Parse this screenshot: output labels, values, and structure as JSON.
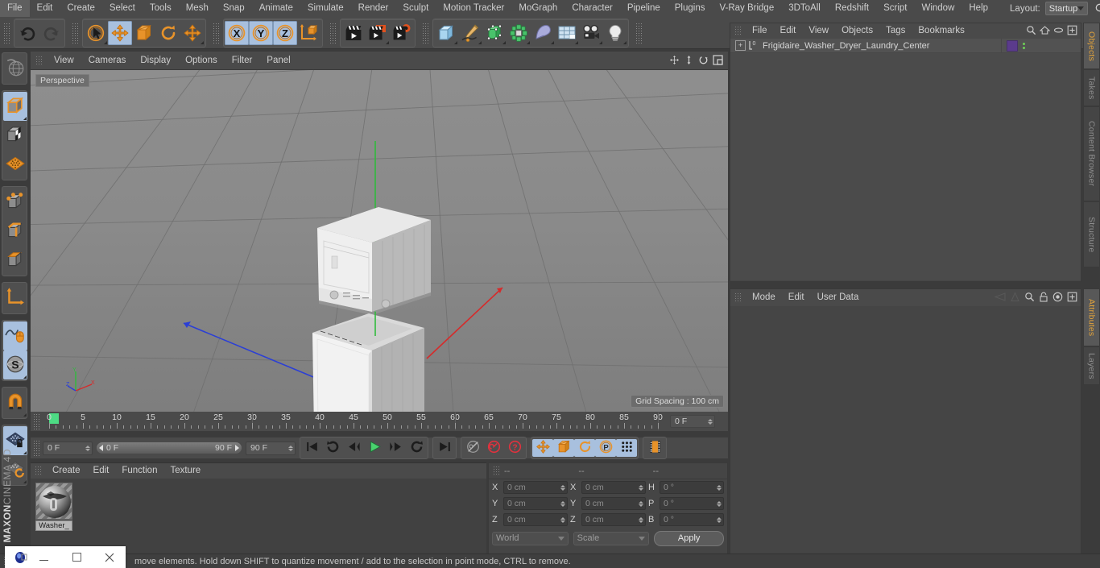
{
  "app": {
    "name": "CINEMA 4D",
    "vendor": "MAXON"
  },
  "menubar": {
    "items": [
      "File",
      "Edit",
      "Create",
      "Select",
      "Tools",
      "Mesh",
      "Snap",
      "Animate",
      "Simulate",
      "Render",
      "Sculpt",
      "Motion Tracker",
      "MoGraph",
      "Character",
      "Pipeline",
      "Plugins",
      "V-Ray Bridge",
      "3DToAll",
      "Redshift",
      "Script",
      "Window",
      "Help"
    ],
    "layout_label": "Layout:",
    "layout_value": "Startup",
    "search_icon": "magnifier-icon"
  },
  "toolbar": {
    "groups": [
      {
        "name": "history",
        "buttons": [
          {
            "name": "undo-button",
            "icon": "undo-arrow-icon",
            "selected": false,
            "corner": false
          },
          {
            "name": "redo-button",
            "icon": "redo-arrow-icon",
            "selected": false,
            "corner": false
          }
        ]
      },
      {
        "name": "transform",
        "buttons": [
          {
            "name": "live-selection-button",
            "icon": "cursor-circle-icon",
            "selected": false,
            "corner": true
          },
          {
            "name": "move-button",
            "icon": "move-arrows-icon",
            "selected": true,
            "corner": false
          },
          {
            "name": "scale-button",
            "icon": "scale-box-icon",
            "selected": false,
            "corner": false
          },
          {
            "name": "rotate-button",
            "icon": "rotate-circle-icon",
            "selected": false,
            "corner": false
          },
          {
            "name": "free-move-button",
            "icon": "move-arrows-icon",
            "selected": false,
            "corner": true
          }
        ]
      },
      {
        "name": "axis-locks",
        "buttons": [
          {
            "name": "x-axis-lock-button",
            "icon": "x-axis-icon",
            "selected": true,
            "corner": false
          },
          {
            "name": "y-axis-lock-button",
            "icon": "y-axis-icon",
            "selected": true,
            "corner": false
          },
          {
            "name": "z-axis-lock-button",
            "icon": "z-axis-icon",
            "selected": true,
            "corner": false
          },
          {
            "name": "world-object-coordinates-button",
            "icon": "world-axis-cube-icon",
            "selected": false,
            "corner": false
          }
        ]
      },
      {
        "name": "render",
        "buttons": [
          {
            "name": "render-view-button",
            "icon": "clapperboard-icon",
            "selected": false,
            "corner": false
          },
          {
            "name": "render-to-picture-viewer-button",
            "icon": "clapperboard-picture-icon",
            "selected": false,
            "corner": true
          },
          {
            "name": "render-settings-button",
            "icon": "clapperboard-gear-icon",
            "selected": false,
            "corner": false
          }
        ]
      },
      {
        "name": "create",
        "buttons": [
          {
            "name": "add-cube-button",
            "icon": "cube-icon",
            "selected": false,
            "corner": true
          },
          {
            "name": "add-spline-button",
            "icon": "pen-spline-icon",
            "selected": false,
            "corner": true
          },
          {
            "name": "add-nurbs-button",
            "icon": "green-nurbs-cube-icon",
            "selected": false,
            "corner": true
          },
          {
            "name": "add-array-button",
            "icon": "green-array-icon",
            "selected": false,
            "corner": true
          },
          {
            "name": "add-deformer-button",
            "icon": "bend-deformer-icon",
            "selected": false,
            "corner": true
          },
          {
            "name": "add-scene-object-button",
            "icon": "floor-grid-icon",
            "selected": false,
            "corner": true
          },
          {
            "name": "add-camera-button",
            "icon": "camera-icon",
            "selected": false,
            "corner": true
          },
          {
            "name": "add-light-button",
            "icon": "light-bulb-icon",
            "selected": false,
            "corner": true
          }
        ]
      }
    ]
  },
  "left_toolbar": {
    "groups": [
      {
        "name": "view-modes",
        "buttons": [
          {
            "name": "make-editable-button",
            "icon": "globe-wire-icon",
            "selected": false,
            "corner": false
          }
        ]
      },
      {
        "name": "selection-modes",
        "buttons": [
          {
            "name": "model-mode-button",
            "icon": "model-cube-icon",
            "selected": true,
            "corner": true
          },
          {
            "name": "texture-mode-button",
            "icon": "texture-checker-cube-icon",
            "selected": false,
            "corner": false
          },
          {
            "name": "uv-mesh-button",
            "icon": "orange-grid-plane-icon",
            "selected": false,
            "corner": false
          }
        ]
      },
      {
        "name": "component-modes",
        "buttons": [
          {
            "name": "points-mode-button",
            "icon": "points-cube-icon",
            "selected": false,
            "corner": false
          },
          {
            "name": "edges-mode-button",
            "icon": "edges-cube-icon",
            "selected": false,
            "corner": false
          },
          {
            "name": "polygons-mode-button",
            "icon": "polygons-cube-icon",
            "selected": false,
            "corner": false
          }
        ]
      },
      {
        "name": "axis-tools",
        "buttons": [
          {
            "name": "enable-axis-button",
            "icon": "axis-corner-icon",
            "selected": false,
            "corner": false
          }
        ]
      },
      {
        "name": "snap-tools",
        "buttons": [
          {
            "name": "workplane-button",
            "icon": "spline-mouse-icon",
            "selected": true,
            "corner": false
          },
          {
            "name": "soft-selection-button",
            "icon": "s-sphere-icon",
            "selected": true,
            "corner": true
          }
        ]
      },
      {
        "name": "magnet",
        "buttons": [
          {
            "name": "magnet-button",
            "icon": "magnet-icon",
            "selected": false,
            "corner": true
          }
        ]
      },
      {
        "name": "workplane",
        "buttons": [
          {
            "name": "lock-workplane-button",
            "icon": "grid-lock-icon",
            "selected": true,
            "corner": true
          },
          {
            "name": "planar-workplane-button",
            "icon": "grid-rotate-icon",
            "selected": false,
            "corner": true
          }
        ]
      }
    ]
  },
  "viewport": {
    "menu_items": [
      "View",
      "Cameras",
      "Display",
      "Options",
      "Filter",
      "Panel"
    ],
    "nav_icons": [
      "pan-icon",
      "dolly-icon",
      "orbit-icon",
      "maximize-viewport-icon"
    ],
    "label": "Perspective",
    "grid_spacing": "Grid Spacing : 100 cm",
    "scene_description": "white stacked washer and dryer laundry center model on grey grid floor"
  },
  "timeline": {
    "ticks": [
      {
        "value": "0",
        "pos": 0
      },
      {
        "value": "5",
        "pos": 5
      },
      {
        "value": "10",
        "pos": 10
      },
      {
        "value": "15",
        "pos": 15
      },
      {
        "value": "20",
        "pos": 20
      },
      {
        "value": "25",
        "pos": 25
      },
      {
        "value": "30",
        "pos": 30
      },
      {
        "value": "35",
        "pos": 35
      },
      {
        "value": "40",
        "pos": 40
      },
      {
        "value": "45",
        "pos": 45
      },
      {
        "value": "50",
        "pos": 50
      },
      {
        "value": "55",
        "pos": 55
      },
      {
        "value": "60",
        "pos": 60
      },
      {
        "value": "65",
        "pos": 65
      },
      {
        "value": "70",
        "pos": 70
      },
      {
        "value": "75",
        "pos": 75
      },
      {
        "value": "80",
        "pos": 80
      },
      {
        "value": "85",
        "pos": 85
      },
      {
        "value": "90",
        "pos": 90
      }
    ],
    "range_min": 0,
    "range_max": 90,
    "current_frame_right": "0 F"
  },
  "transport": {
    "current_frame": "0 F",
    "range_start": "0 F",
    "range_end": "90 F",
    "end_frame": "90 F",
    "buttons": [
      {
        "name": "go-to-start-button",
        "icon": "skip-start-icon",
        "selected": false
      },
      {
        "name": "play-backwards-loop-button",
        "icon": "loop-back-icon",
        "selected": false
      },
      {
        "name": "step-back-button",
        "icon": "step-back-icon",
        "selected": false
      },
      {
        "name": "play-button",
        "icon": "play-icon",
        "selected": false
      },
      {
        "name": "step-forward-button",
        "icon": "step-forward-icon",
        "selected": false
      },
      {
        "name": "play-forward-loop-button",
        "icon": "loop-forward-icon",
        "selected": false
      },
      {
        "name": "go-to-end-button",
        "icon": "skip-end-icon",
        "selected": false
      },
      {
        "name": "record-active-objects-button",
        "icon": "key-disabled-icon",
        "selected": false
      },
      {
        "name": "autokeying-button",
        "icon": "red-record-icon",
        "selected": false
      },
      {
        "name": "keyframe-selection-button",
        "icon": "red-question-icon",
        "selected": false
      },
      {
        "name": "position-key-button",
        "icon": "move-arrows-icon",
        "selected": true
      },
      {
        "name": "scale-key-button",
        "icon": "scale-box-icon",
        "selected": true
      },
      {
        "name": "rotation-key-button",
        "icon": "rotate-circle-icon",
        "selected": true
      },
      {
        "name": "parameter-key-button",
        "icon": "p-circle-icon",
        "selected": true
      },
      {
        "name": "point-level-animation-button",
        "icon": "dots-grid-icon",
        "selected": true
      },
      {
        "name": "timeline-view-button",
        "icon": "filmstrip-icon",
        "selected": false
      }
    ]
  },
  "material_manager": {
    "menu_items": [
      "Create",
      "Edit",
      "Function",
      "Texture"
    ],
    "materials": [
      {
        "name": "Washer_",
        "preview": "checkered-sphere-preview"
      }
    ]
  },
  "coordinates": {
    "header_cols": [
      "--",
      "--",
      "--"
    ],
    "rows": [
      {
        "label1": "X",
        "value1": "0 cm",
        "label2": "X",
        "value2": "0 cm",
        "label3": "H",
        "value3": "0 °"
      },
      {
        "label1": "Y",
        "value1": "0 cm",
        "label2": "Y",
        "value2": "0 cm",
        "label3": "P",
        "value3": "0 °"
      },
      {
        "label1": "Z",
        "value1": "0 cm",
        "label2": "Z",
        "value2": "0 cm",
        "label3": "B",
        "value3": "0 °"
      }
    ],
    "system_select": "World",
    "mode_select": "Scale",
    "apply_label": "Apply"
  },
  "object_manager": {
    "menu_items": [
      "File",
      "Edit",
      "View",
      "Objects",
      "Tags",
      "Bookmarks"
    ],
    "header_icons": [
      "search-icon",
      "home-icon",
      "ellipse-icon",
      "expand-icon"
    ],
    "objects": [
      {
        "name": "Frigidaire_Washer_Dryer_Laundry_Center",
        "layer_color": "#5b3b8c",
        "icon": "null-object-icon",
        "expandable": true
      }
    ]
  },
  "attribute_manager": {
    "menu_items": [
      "Mode",
      "Edit",
      "User Data"
    ],
    "header_icons": [
      "prev-icon",
      "next-icon",
      "search-icon",
      "lock-icon",
      "target-icon",
      "expand-icon"
    ],
    "body_empty": true
  },
  "right_tabs": [
    {
      "label": "Objects",
      "active": true
    },
    {
      "label": "Takes",
      "active": false
    },
    {
      "label": "Content Browser",
      "active": false
    },
    {
      "label": "Structure",
      "active": false
    },
    {
      "label": "Attributes",
      "active": true
    },
    {
      "label": "Layers",
      "active": false
    }
  ],
  "statusbar": {
    "text": "move elements. Hold down SHIFT to quantize movement / add to the selection in point mode, CTRL to remove."
  },
  "window_controls": {
    "logo_icon": "cinema4d-logo-icon",
    "minimize_icon": "minimize-icon",
    "maximize_icon": "maximize-square-icon",
    "close_icon": "close-x-icon"
  },
  "colors": {
    "panel_bg": "#454545",
    "toolbar_bg": "#4a4a4a",
    "accent_orange": "#e0a23c",
    "selected_blue": "#a8c0de",
    "viewport_grey": "#868686"
  }
}
